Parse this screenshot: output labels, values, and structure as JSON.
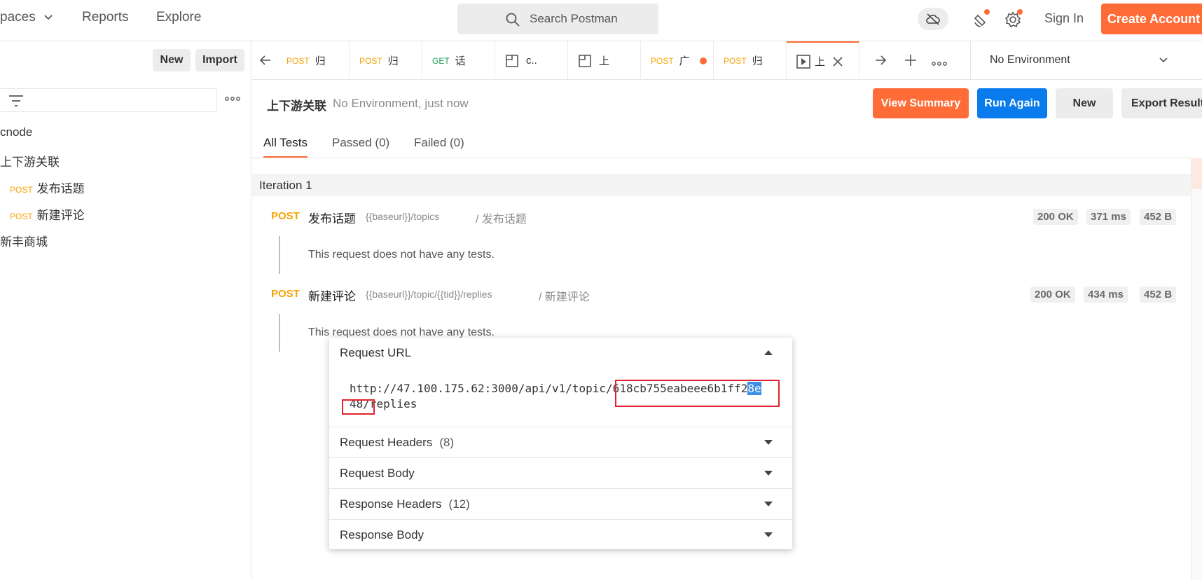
{
  "header": {
    "nav": [
      "paces",
      "Reports",
      "Explore"
    ],
    "search_placeholder": "Search Postman",
    "sign_in": "Sign In",
    "create_account": "Create Account"
  },
  "sidebar": {
    "new_label": "New",
    "import_label": "Import",
    "tree": [
      {
        "label": "cnode"
      },
      {
        "label": "上下游关联"
      },
      {
        "method": "POST",
        "label": "发布话题"
      },
      {
        "method": "POST",
        "label": "新建评论"
      },
      {
        "label": "新丰商城"
      }
    ]
  },
  "tabs": [
    {
      "method": "POST",
      "title": "归"
    },
    {
      "method": "POST",
      "title": "归"
    },
    {
      "method": "GET",
      "title": "话"
    },
    {
      "method": "",
      "title": "c.."
    },
    {
      "method": "",
      "title": "上"
    },
    {
      "method": "POST",
      "title": "广"
    },
    {
      "method": "POST",
      "title": "归"
    },
    {
      "method": "",
      "title": "上"
    }
  ],
  "environment": {
    "selected": "No Environment"
  },
  "runner": {
    "collection_name": "上下游关联",
    "subtitle": "No Environment, just now",
    "buttons": {
      "view_summary": "View Summary",
      "run_again": "Run Again",
      "new": "New",
      "export": "Export Results"
    },
    "tabs": [
      "All Tests",
      "Passed (0)",
      "Failed (0)"
    ],
    "iteration": "Iteration 1",
    "results": [
      {
        "method": "POST",
        "name": "发布话题",
        "url": "{{baseurl}}/topics",
        "path": "/ 发布话题",
        "status": "200 OK",
        "time": "371 ms",
        "size": "452 B",
        "note": "This request does not have any tests."
      },
      {
        "method": "POST",
        "name": "新建评论",
        "url": "{{baseurl}}/topic/{{tid}}/replies",
        "path": "/ 新建评论",
        "status": "200 OK",
        "time": "434 ms",
        "size": "452 B",
        "note": "This request does not have any tests."
      }
    ]
  },
  "popover": {
    "request_url_label": "Request URL",
    "url_line1_a": "http://47.100.175.62:3000/api/v1/topic/618cb755eabeee6b1ff2",
    "url_line1_sel": "8e",
    "url_line2": "48/replies",
    "sections": [
      {
        "label": "Request Headers",
        "count": "(8)"
      },
      {
        "label": "Request Body",
        "count": ""
      },
      {
        "label": "Response Headers",
        "count": "(12)"
      },
      {
        "label": "Response Body",
        "count": ""
      }
    ]
  },
  "colors": {
    "accent": "#ff6c37",
    "primary": "#097bed",
    "post": "#f8a200",
    "get": "#1c9b4f",
    "highlight_box": "#e0232e"
  }
}
